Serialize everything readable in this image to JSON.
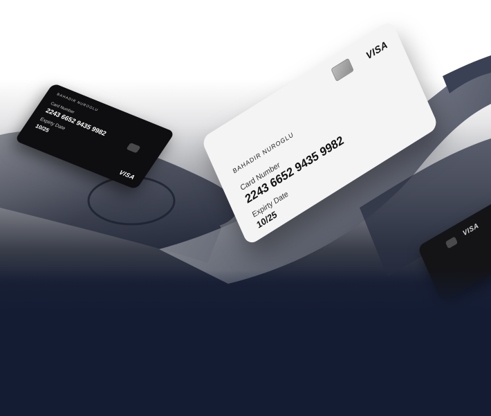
{
  "cards": {
    "white": {
      "holder": "BAHADIR NUROGLU",
      "number_label": "Card Number",
      "number": "2243 6652 9435 9982",
      "expiry_label": "Expirty Date",
      "expiry": "10/25",
      "brand": "VISA"
    },
    "black": {
      "holder": "BAHADIR NUROGLU",
      "number_label": "Card Number",
      "number": "2243 6652 9435 9982",
      "expiry_label": "Expirty Date",
      "expiry": "10/25",
      "brand": "VISA"
    },
    "partial": {
      "brand": "VISA"
    }
  },
  "colors": {
    "background_dark": "#141c33",
    "card_white": "#f4f4f4",
    "card_black": "#0e0e10"
  }
}
